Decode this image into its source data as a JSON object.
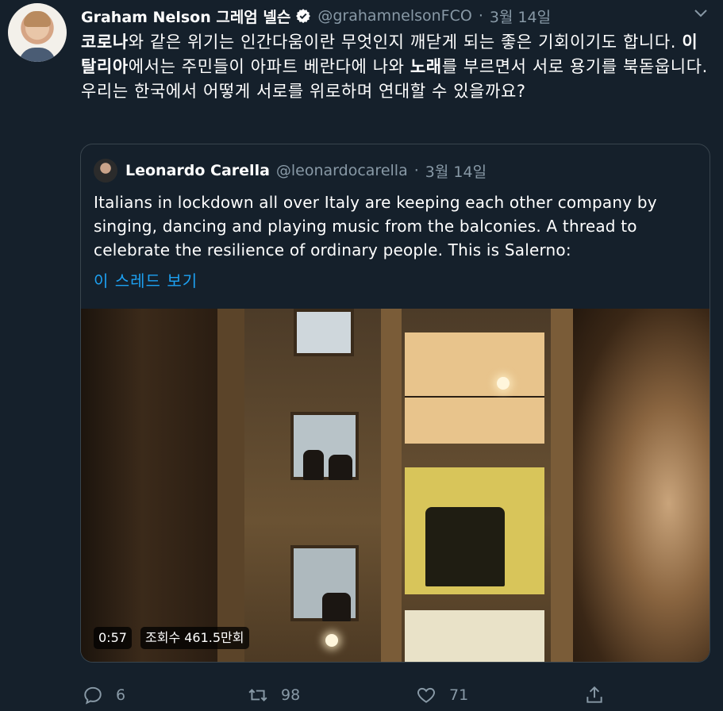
{
  "tweet": {
    "author_name": "Graham Nelson 그레엄 넬슨",
    "handle": "@grahamnelsonFCO",
    "separator": "·",
    "date": "3월 14일",
    "text_segments": [
      {
        "text": "코로나",
        "bold": true
      },
      {
        "text": "와 같은 위기는 인간다움이란 무엇인지 깨닫게 되는 좋은 기회이기도 합니다. ",
        "bold": false
      },
      {
        "text": "이탈리아",
        "bold": true
      },
      {
        "text": "에서는 주민들이 아파트 베란다에 나와 ",
        "bold": false
      },
      {
        "text": "노래",
        "bold": true
      },
      {
        "text": "를 부르면서 서로 용기를 북돋웁니다.  우리는 한국에서 어떻게 서로를 위로하며 연대할 수 있을까요?",
        "bold": false
      }
    ]
  },
  "quoted": {
    "author_name": "Leonardo Carella",
    "handle": "@leonardocarella",
    "separator": "·",
    "date": "3월 14일",
    "text": "Italians in lockdown all over Italy are keeping each other company by singing, dancing and playing music from the balconies. A thread to celebrate the resilience of ordinary people. This is Salerno:",
    "thread_link": "이 스레드 보기",
    "video": {
      "duration": "0:57",
      "views": "조회수 461.5만회"
    }
  },
  "actions": {
    "reply_count": "6",
    "retweet_count": "98",
    "like_count": "71"
  },
  "icons": {
    "verified": "verified-badge-icon",
    "caret": "chevron-down-icon",
    "reply": "reply-icon",
    "retweet": "retweet-icon",
    "like": "heart-icon",
    "share": "share-icon"
  },
  "colors": {
    "background": "#15202b",
    "secondary_text": "#8899a6",
    "link": "#1da1f2",
    "border": "#38444d"
  }
}
